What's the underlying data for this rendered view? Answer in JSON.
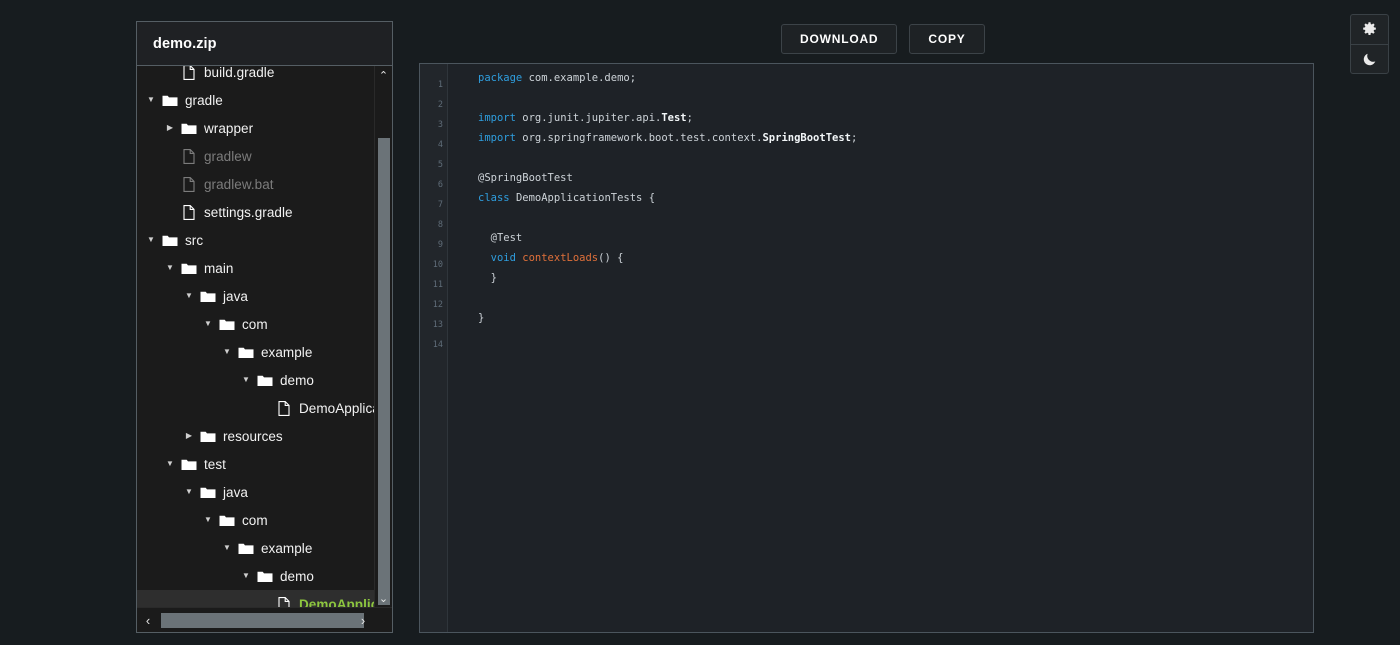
{
  "theme_rail": {
    "light_label": "gear-icon",
    "dark_label": "moon-icon"
  },
  "toolbar": {
    "download_label": "DOWNLOAD",
    "copy_label": "COPY"
  },
  "tree": {
    "title": "demo.zip",
    "scroll": {
      "up_arrow": "⌃",
      "down_arrow": "⌄",
      "left_arrow": "‹",
      "right_arrow": "›"
    },
    "items": [
      {
        "label": "build.gradle",
        "type": "file",
        "depth": 1,
        "state": "none",
        "style": "normal"
      },
      {
        "label": "gradle",
        "type": "folder",
        "depth": 0,
        "state": "expanded",
        "style": "normal"
      },
      {
        "label": "wrapper",
        "type": "folder",
        "depth": 1,
        "state": "collapsed",
        "style": "normal"
      },
      {
        "label": "gradlew",
        "type": "file",
        "depth": 1,
        "state": "none",
        "style": "dim"
      },
      {
        "label": "gradlew.bat",
        "type": "file",
        "depth": 1,
        "state": "none",
        "style": "dim"
      },
      {
        "label": "settings.gradle",
        "type": "file",
        "depth": 1,
        "state": "none",
        "style": "normal"
      },
      {
        "label": "src",
        "type": "folder",
        "depth": 0,
        "state": "expanded",
        "style": "normal"
      },
      {
        "label": "main",
        "type": "folder",
        "depth": 1,
        "state": "expanded",
        "style": "normal"
      },
      {
        "label": "java",
        "type": "folder",
        "depth": 2,
        "state": "expanded",
        "style": "normal"
      },
      {
        "label": "com",
        "type": "folder",
        "depth": 3,
        "state": "expanded",
        "style": "normal"
      },
      {
        "label": "example",
        "type": "folder",
        "depth": 4,
        "state": "expanded",
        "style": "normal"
      },
      {
        "label": "demo",
        "type": "folder",
        "depth": 5,
        "state": "expanded",
        "style": "normal"
      },
      {
        "label": "DemoApplication.java",
        "type": "file",
        "depth": 6,
        "state": "none",
        "style": "normal"
      },
      {
        "label": "resources",
        "type": "folder",
        "depth": 2,
        "state": "collapsed",
        "style": "normal"
      },
      {
        "label": "test",
        "type": "folder",
        "depth": 1,
        "state": "expanded",
        "style": "normal"
      },
      {
        "label": "java",
        "type": "folder",
        "depth": 2,
        "state": "expanded",
        "style": "normal"
      },
      {
        "label": "com",
        "type": "folder",
        "depth": 3,
        "state": "expanded",
        "style": "normal"
      },
      {
        "label": "example",
        "type": "folder",
        "depth": 4,
        "state": "expanded",
        "style": "normal"
      },
      {
        "label": "demo",
        "type": "folder",
        "depth": 5,
        "state": "expanded",
        "style": "normal"
      },
      {
        "label": "DemoApplicationTests.java",
        "type": "file",
        "depth": 6,
        "state": "none",
        "style": "selected"
      }
    ]
  },
  "editor": {
    "line_numbers": [
      "1",
      "2",
      "3",
      "4",
      "5",
      "6",
      "7",
      "8",
      "9",
      "10",
      "11",
      "12",
      "13",
      "14"
    ],
    "lines": [
      [
        {
          "t": "package ",
          "c": "kw"
        },
        {
          "t": "com.example.demo;",
          "c": "pl"
        }
      ],
      [],
      [
        {
          "t": "import ",
          "c": "kw"
        },
        {
          "t": "org.junit.jupiter.api.",
          "c": "pl"
        },
        {
          "t": "Test",
          "c": "cls"
        },
        {
          "t": ";",
          "c": "pl"
        }
      ],
      [
        {
          "t": "import ",
          "c": "kw"
        },
        {
          "t": "org.springframework.boot.test.context.",
          "c": "pl"
        },
        {
          "t": "SpringBootTest",
          "c": "cls"
        },
        {
          "t": ";",
          "c": "pl"
        }
      ],
      [],
      [
        {
          "t": "@SpringBootTest",
          "c": "ann"
        }
      ],
      [
        {
          "t": "class ",
          "c": "kw"
        },
        {
          "t": "DemoApplicationTests",
          "c": "pl"
        },
        {
          "t": " {",
          "c": "pl"
        }
      ],
      [],
      [
        {
          "t": "  @Test",
          "c": "ann"
        }
      ],
      [
        {
          "t": "  void ",
          "c": "kw"
        },
        {
          "t": "contextLoads",
          "c": "fn"
        },
        {
          "t": "() {",
          "c": "pl"
        }
      ],
      [
        {
          "t": "  }",
          "c": "pl"
        }
      ],
      [],
      [
        {
          "t": "}",
          "c": "pl"
        }
      ],
      []
    ]
  },
  "colors": {
    "page_bg": "#171c1f",
    "panel_bg": "#1b1b1b",
    "panel_border": "#555e64",
    "editor_bg": "#1e2227",
    "editor_border": "#4b555d",
    "gutter_bg": "#22262b",
    "keyword": "#2f9ede",
    "function": "#e0703a",
    "plain": "#cdd3d8",
    "line_number": "#5f6c78",
    "selected_file": "#8dc63f",
    "selected_row_bg": "#2e2e2e",
    "dim_file": "#7c7c7c",
    "scroll_thumb": "#6b7378"
  }
}
